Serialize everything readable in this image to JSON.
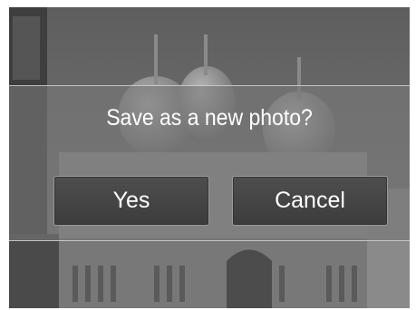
{
  "dialog": {
    "prompt": "Save as a new photo?",
    "yes_label": "Yes",
    "cancel_label": "Cancel"
  },
  "colors": {
    "overlay": "#7a7a7a",
    "button_fill": "#454545",
    "button_border": "#9a9a9a",
    "text": "#ffffff"
  }
}
